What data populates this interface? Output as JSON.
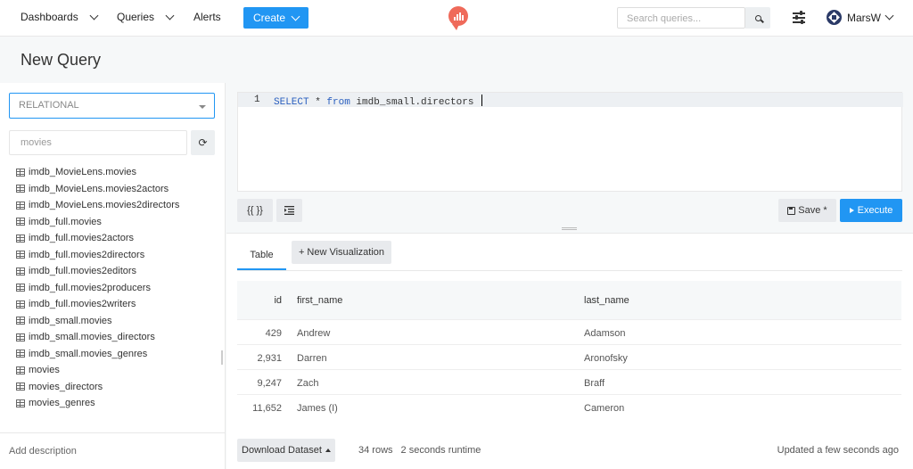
{
  "nav": {
    "dashboards": "Dashboards",
    "queries": "Queries",
    "alerts": "Alerts",
    "create": "Create",
    "search_placeholder": "Search queries...",
    "user": "MarsW"
  },
  "page": {
    "title": "New Query"
  },
  "sidebar": {
    "datasource": "RELATIONAL",
    "schema_filter": "movies",
    "tables": [
      "imdb_MovieLens.movies",
      "imdb_MovieLens.movies2actors",
      "imdb_MovieLens.movies2directors",
      "imdb_full.movies",
      "imdb_full.movies2actors",
      "imdb_full.movies2directors",
      "imdb_full.movies2editors",
      "imdb_full.movies2producers",
      "imdb_full.movies2writers",
      "imdb_small.movies",
      "imdb_small.movies_directors",
      "imdb_small.movies_genres",
      "movies",
      "movies_directors",
      "movies_genres"
    ],
    "description": "Add description"
  },
  "editor": {
    "line_number": "1",
    "keyword_select": "SELECT",
    "star": " * ",
    "keyword_from": "from",
    "table": " imdb_small.directors ",
    "param_button": "{{ }}",
    "save": "Save *",
    "execute": "Execute"
  },
  "results": {
    "tab_table": "Table",
    "tab_new_viz": "+ New Visualization",
    "columns": [
      "id",
      "first_name",
      "last_name"
    ],
    "rows": [
      [
        "429",
        "Andrew",
        "Adamson"
      ],
      [
        "2,931",
        "Darren",
        "Aronofsky"
      ],
      [
        "9,247",
        "Zach",
        "Braff"
      ],
      [
        "11,652",
        "James (I)",
        "Cameron"
      ]
    ]
  },
  "footer": {
    "download": "Download Dataset",
    "rows": "34 rows",
    "runtime": "2 seconds runtime",
    "updated": "Updated a few seconds ago"
  },
  "colors": {
    "accent": "#2196f3",
    "logo": "#ef6a5a"
  }
}
